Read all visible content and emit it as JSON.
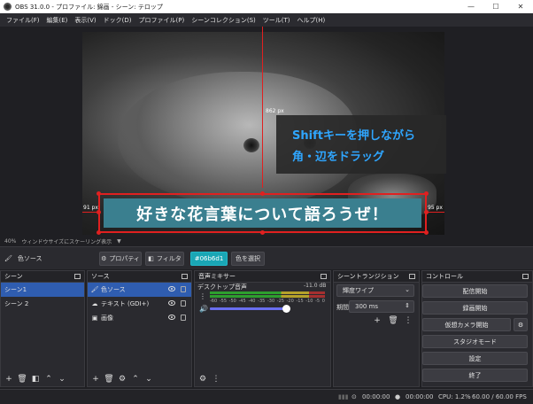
{
  "window": {
    "title": "OBS 31.0.0 - プロファイル: 錦画 - シーン: テロップ",
    "minimize": "—",
    "maximize": "☐",
    "close": "✕"
  },
  "menu": [
    "ファイル(F)",
    "編集(E)",
    "表示(V)",
    "ドック(D)",
    "プロファイル(P)",
    "シーンコレクション(S)",
    "ツール(T)",
    "ヘルプ(H)"
  ],
  "preview": {
    "top_distance": "862 px",
    "left_distance": "91 px",
    "right_distance": "95 px",
    "overlay_line1": "Shiftキーを押しながら",
    "overlay_line2": "角・辺をドラッグ",
    "telop_text": "好きな花言葉について語ろうぜ！",
    "zoom": "40%",
    "scale_mode": "ウィンドウサイズにスケーリング表示"
  },
  "properties_bar": {
    "source_name": "色ソース",
    "properties_label": "プロパティ",
    "filters_label": "フィルタ",
    "color_value": "#06b6d1",
    "select_color_label": "色を選択"
  },
  "scenes": {
    "title": "シーン",
    "items": [
      {
        "label": "シーン1",
        "selected": true
      },
      {
        "label": "シーン 2",
        "selected": false
      }
    ]
  },
  "sources": {
    "title": "ソース",
    "items": [
      {
        "label": "色ソース",
        "icon": "paint-bucket-icon",
        "selected": true
      },
      {
        "label": "テキスト (GDI+)",
        "icon": "text-icon",
        "selected": false
      },
      {
        "label": "画像",
        "icon": "image-icon",
        "selected": false
      }
    ]
  },
  "mixer": {
    "title": "音声ミキサー",
    "channel": "デスクトップ音声",
    "db": "-11.0 dB",
    "ticks": [
      "-60",
      "-55",
      "-50",
      "-45",
      "-40",
      "-35",
      "-30",
      "-25",
      "-20",
      "-15",
      "-10",
      "-5",
      "0"
    ],
    "volume_level": 0.95
  },
  "transitions": {
    "title": "シーントランジション",
    "selected": "輝度ワイプ",
    "duration_label": "期間",
    "duration_value": "300 ms"
  },
  "controls": {
    "title": "コントロール",
    "buttons": [
      "配信開始",
      "録画開始",
      "仮想カメラ開始",
      "スタジオモード",
      "設定",
      "終了"
    ]
  },
  "status": {
    "stream_time": "00:00:00",
    "record_time": "00:00:00",
    "cpu": "CPU: 1.2%",
    "fps": "60.00 / 60.00 FPS"
  },
  "colors": {
    "selection": "#2f5db0",
    "accent": "#1aa6b5",
    "guide": "#e02020",
    "telop_bg": "#3a7f8f",
    "tooltip_text": "#2fa6ff"
  }
}
